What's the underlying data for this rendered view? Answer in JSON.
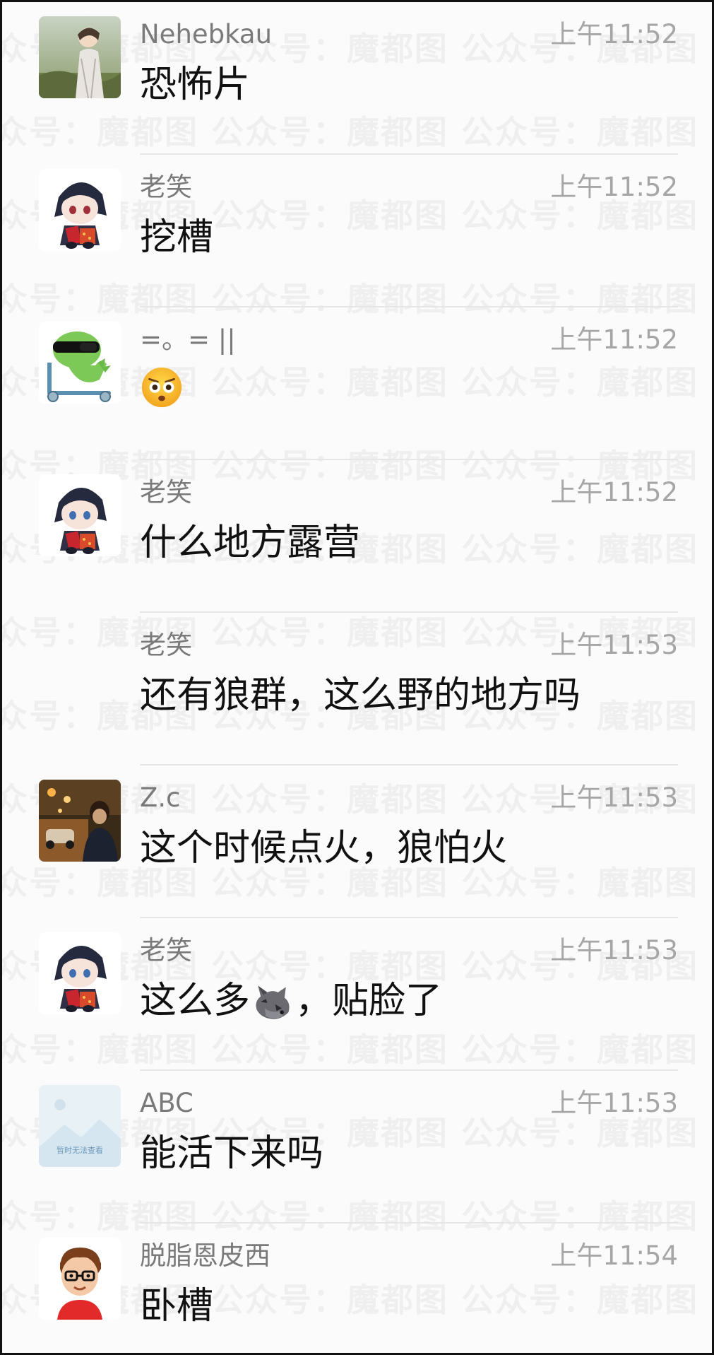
{
  "watermark_text": "众号：魔都图 公众号：魔都图 公众号：魔都图 公众号：魔都图",
  "messages": [
    {
      "name": "Nehebkau",
      "time": "上午11:52",
      "text": "恐怖片",
      "avatar": "anime-boy-landscape"
    },
    {
      "name": "老笑",
      "time": "上午11:52",
      "text": "挖槽",
      "avatar": "chibi-vampire"
    },
    {
      "name": "=。= ||",
      "time": "上午11:52",
      "text": "",
      "emoji": "flushed-face",
      "avatar": "green-dino-sunglasses-scooter"
    },
    {
      "name": "老笑",
      "time": "上午11:52",
      "text": "什么地方露营",
      "avatar": "chibi-vampire"
    },
    {
      "name": "老笑",
      "time": "上午11:53",
      "text": "还有狼群，这么野的地方吗",
      "avatar": "none"
    },
    {
      "name": "Z.c",
      "time": "上午11:53",
      "text": "这个时候点火，狼怕火",
      "avatar": "night-street-photo"
    },
    {
      "name": "老笑",
      "time": "上午11:53",
      "text_before": "这么多",
      "emoji": "wolf",
      "text_after": "，贴脸了",
      "avatar": "chibi-vampire"
    },
    {
      "name": "ABC",
      "time": "上午11:53",
      "text": "能活下来吗",
      "avatar": "placeholder-image",
      "avatar_caption": "暂时无法查看"
    },
    {
      "name": "脱脂恩皮西",
      "time": "上午11:54",
      "text": "卧槽",
      "avatar": "glasses-boy-red-shirt"
    }
  ]
}
